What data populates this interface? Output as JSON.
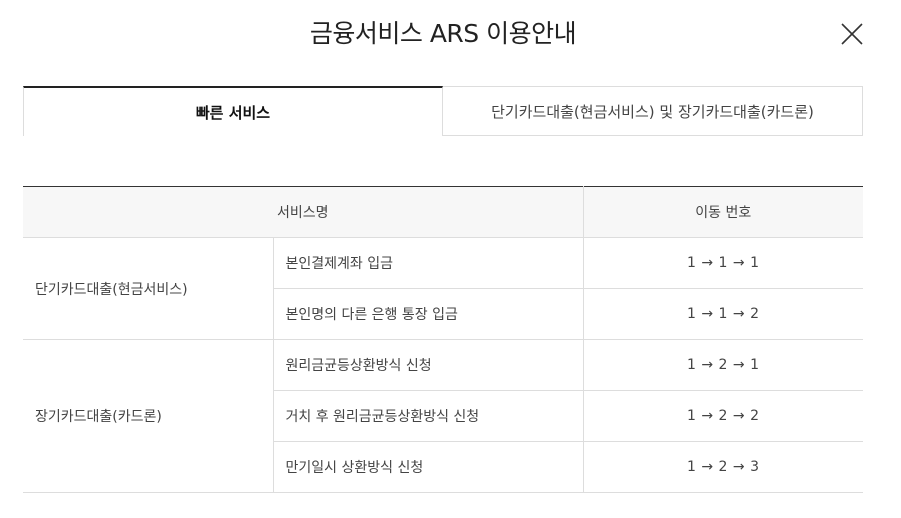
{
  "modal": {
    "title": "금융서비스 ARS 이용안내",
    "close_icon": "close-icon"
  },
  "tabs": [
    {
      "label": "빠른 서비스",
      "active": true
    },
    {
      "label": "단기카드대출(현금서비스) 및 장기카드대출(카드론)",
      "active": false
    }
  ],
  "table": {
    "headers": {
      "service_name": "서비스명",
      "number": "이동 번호"
    },
    "groups": [
      {
        "name": "단기카드대출(현금서비스)",
        "rows": [
          {
            "service": "본인결제계좌 입금",
            "number": "1 → 1 → 1"
          },
          {
            "service": "본인명의 다른 은행 통장 입금",
            "number": "1 → 1 → 2"
          }
        ]
      },
      {
        "name": "장기카드대출(카드론)",
        "rows": [
          {
            "service": "원리금균등상환방식 신청",
            "number": "1 → 2 → 1"
          },
          {
            "service": "거치 후 원리금균등상환방식 신청",
            "number": "1 → 2 → 2"
          },
          {
            "service": "만기일시 상환방식 신청",
            "number": "1 → 2 → 3"
          }
        ]
      }
    ]
  }
}
